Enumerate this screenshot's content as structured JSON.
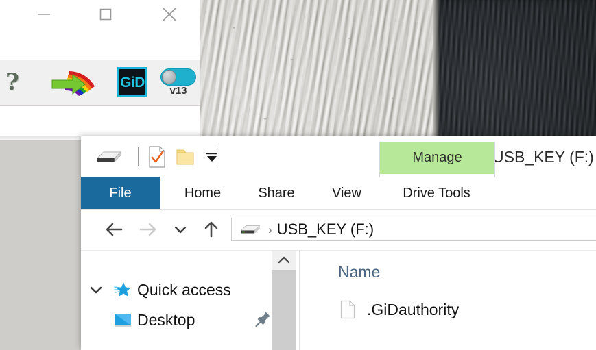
{
  "desktop": {
    "wallpaper_description": "granite-rock-texture-photo",
    "light_stone_color": "#c5c3bc",
    "dark_stone_color": "#22262a"
  },
  "gid_window": {
    "title_bar": {
      "minimize_label": "Minimize",
      "maximize_label": "Maximize",
      "close_label": "Close"
    },
    "toolbar": {
      "help_glyph": "?",
      "rainbow_arrow_label": "rainbow-arrow",
      "logo_text": "GiD",
      "version_label": "v13",
      "accent_color": "#18b6d8"
    }
  },
  "explorer": {
    "title": "USB_KEY (F:)",
    "quick_access_toolbar": {
      "drive_icon_label": "drive",
      "properties_icon_label": "properties",
      "new_folder_icon_label": "new-folder",
      "customize_icon_label": "customize"
    },
    "contextual_group": {
      "header": "Manage",
      "header_color": "#b7e89a",
      "tab": "Drive Tools"
    },
    "tabs": [
      {
        "label": "File",
        "active": true,
        "color": "#1a6a9e"
      },
      {
        "label": "Home",
        "active": false
      },
      {
        "label": "Share",
        "active": false
      },
      {
        "label": "View",
        "active": false
      }
    ],
    "address_bar": {
      "back_label": "Back",
      "forward_label": "Forward",
      "recent_label": "Recent locations",
      "up_label": "Up one level",
      "path": "USB_KEY (F:)",
      "separator": "›"
    },
    "navigation_pane": {
      "items": [
        {
          "label": "Quick access",
          "icon": "star-icon",
          "expanded": true
        },
        {
          "label": "Desktop",
          "icon": "desktop-icon",
          "pinned": true
        }
      ]
    },
    "content_pane": {
      "columns": [
        "Name"
      ],
      "files": [
        {
          "name": ".GiDauthority",
          "icon": "generic-file-icon"
        }
      ]
    }
  }
}
